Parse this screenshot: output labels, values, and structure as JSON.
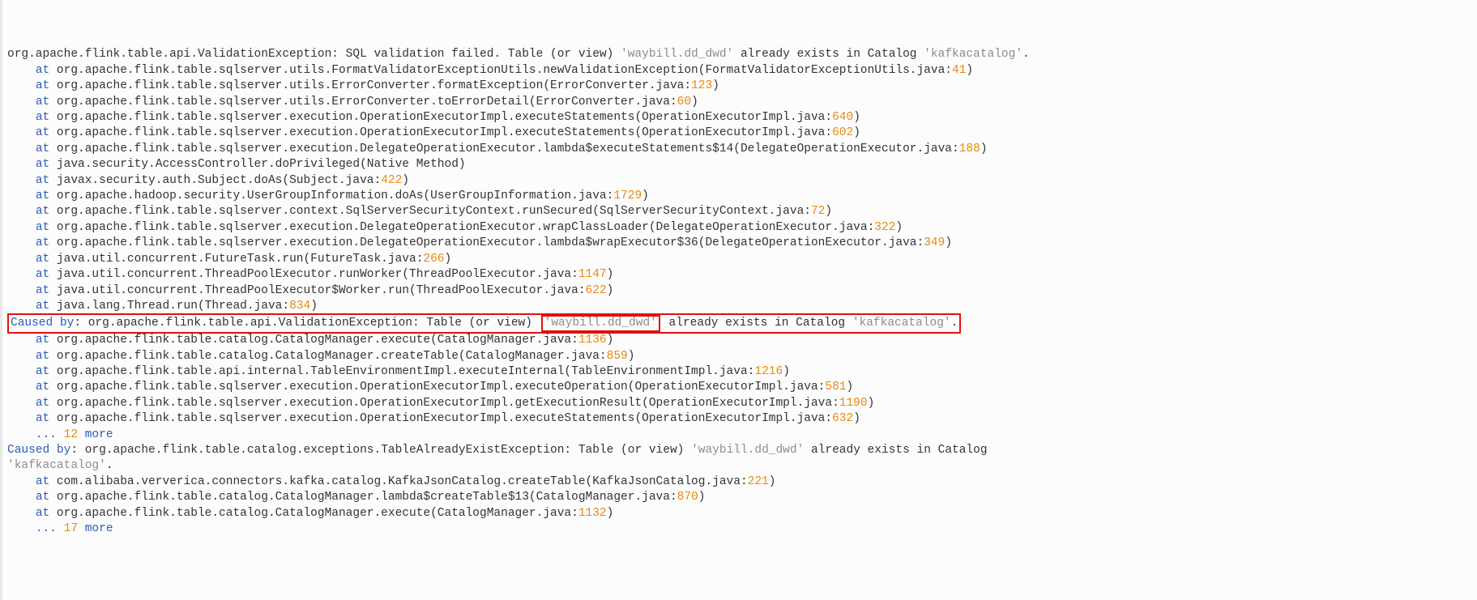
{
  "stacktrace": {
    "header": {
      "class": "org.apache.flink.table.api.ValidationException",
      "msg_prefix": ": SQL validation failed. Table (or view) ",
      "table": "'waybill.dd_dwd'",
      "msg_mid": " already exists in Catalog ",
      "catalog": "'kafkacatalog'",
      "msg_suffix": "."
    },
    "frames1": [
      {
        "at": "at",
        "loc": "org.apache.flink.table.sqlserver.utils.FormatValidatorExceptionUtils.newValidationException(FormatValidatorExceptionUtils.java:",
        "ln": "41",
        "end": ")"
      },
      {
        "at": "at",
        "loc": "org.apache.flink.table.sqlserver.utils.ErrorConverter.formatException(ErrorConverter.java:",
        "ln": "123",
        "end": ")"
      },
      {
        "at": "at",
        "loc": "org.apache.flink.table.sqlserver.utils.ErrorConverter.toErrorDetail(ErrorConverter.java:",
        "ln": "60",
        "end": ")"
      },
      {
        "at": "at",
        "loc": "org.apache.flink.table.sqlserver.execution.OperationExecutorImpl.executeStatements(OperationExecutorImpl.java:",
        "ln": "640",
        "end": ")"
      },
      {
        "at": "at",
        "loc": "org.apache.flink.table.sqlserver.execution.OperationExecutorImpl.executeStatements(OperationExecutorImpl.java:",
        "ln": "602",
        "end": ")"
      },
      {
        "at": "at",
        "loc": "org.apache.flink.table.sqlserver.execution.DelegateOperationExecutor.lambda$executeStatements$14(DelegateOperationExecutor.java:",
        "ln": "188",
        "end": ")"
      },
      {
        "at": "at",
        "loc": "java.security.AccessController.doPrivileged(Native Method)",
        "ln": "",
        "end": ""
      },
      {
        "at": "at",
        "loc": "javax.security.auth.Subject.doAs(Subject.java:",
        "ln": "422",
        "end": ")"
      },
      {
        "at": "at",
        "loc": "org.apache.hadoop.security.UserGroupInformation.doAs(UserGroupInformation.java:",
        "ln": "1729",
        "end": ")"
      },
      {
        "at": "at",
        "loc": "org.apache.flink.table.sqlserver.context.SqlServerSecurityContext.runSecured(SqlServerSecurityContext.java:",
        "ln": "72",
        "end": ")"
      },
      {
        "at": "at",
        "loc": "org.apache.flink.table.sqlserver.execution.DelegateOperationExecutor.wrapClassLoader(DelegateOperationExecutor.java:",
        "ln": "322",
        "end": ")"
      },
      {
        "at": "at",
        "loc": "org.apache.flink.table.sqlserver.execution.DelegateOperationExecutor.lambda$wrapExecutor$36(DelegateOperationExecutor.java:",
        "ln": "349",
        "end": ")"
      },
      {
        "at": "at",
        "loc": "java.util.concurrent.FutureTask.run(FutureTask.java:",
        "ln": "266",
        "end": ")"
      },
      {
        "at": "at",
        "loc": "java.util.concurrent.ThreadPoolExecutor.runWorker(ThreadPoolExecutor.java:",
        "ln": "1147",
        "end": ")"
      },
      {
        "at": "at",
        "loc": "java.util.concurrent.ThreadPoolExecutor$Worker.run(ThreadPoolExecutor.java:",
        "ln": "622",
        "end": ")"
      },
      {
        "at": "at",
        "loc": "java.lang.Thread.run(Thread.java:",
        "ln": "834",
        "end": ")"
      }
    ],
    "cause1": {
      "prefix": "Caused by",
      "class": ": org.apache.flink.table.api.ValidationException: Table (or view) ",
      "table": "'waybill.dd_dwd'",
      "mid": " already exists in Catalog ",
      "catalog": "'kafkacatalog'",
      "suffix": "."
    },
    "frames2": [
      {
        "at": "at",
        "loc": "org.apache.flink.table.catalog.CatalogManager.execute(CatalogManager.java:",
        "ln": "1136",
        "end": ")"
      },
      {
        "at": "at",
        "loc": "org.apache.flink.table.catalog.CatalogManager.createTable(CatalogManager.java:",
        "ln": "859",
        "end": ")"
      },
      {
        "at": "at",
        "loc": "org.apache.flink.table.api.internal.TableEnvironmentImpl.executeInternal(TableEnvironmentImpl.java:",
        "ln": "1216",
        "end": ")"
      },
      {
        "at": "at",
        "loc": "org.apache.flink.table.sqlserver.execution.OperationExecutorImpl.executeOperation(OperationExecutorImpl.java:",
        "ln": "581",
        "end": ")"
      },
      {
        "at": "at",
        "loc": "org.apache.flink.table.sqlserver.execution.OperationExecutorImpl.getExecutionResult(OperationExecutorImpl.java:",
        "ln": "1190",
        "end": ")"
      },
      {
        "at": "at",
        "loc": "org.apache.flink.table.sqlserver.execution.OperationExecutorImpl.executeStatements(OperationExecutorImpl.java:",
        "ln": "632",
        "end": ")"
      }
    ],
    "more1": {
      "dots": "...",
      "n": "12",
      "more": "more"
    },
    "cause2": {
      "prefix": "Caused by",
      "class": ": org.apache.flink.table.catalog.exceptions.TableAlreadyExistException: Table (or view) ",
      "table": "'waybill.dd_dwd'",
      "mid": " already exists in Catalog ",
      "catalog_line2": "'kafkacatalog'",
      "suffix": "."
    },
    "frames3": [
      {
        "at": "at",
        "loc": "com.alibaba.ververica.connectors.kafka.catalog.KafkaJsonCatalog.createTable(KafkaJsonCatalog.java:",
        "ln": "221",
        "end": ")"
      },
      {
        "at": "at",
        "loc": "org.apache.flink.table.catalog.CatalogManager.lambda$createTable$13(CatalogManager.java:",
        "ln": "870",
        "end": ")"
      },
      {
        "at": "at",
        "loc": "org.apache.flink.table.catalog.CatalogManager.execute(CatalogManager.java:",
        "ln": "1132",
        "end": ")"
      }
    ],
    "more2": {
      "dots": "...",
      "n": "17",
      "more": "more"
    }
  }
}
